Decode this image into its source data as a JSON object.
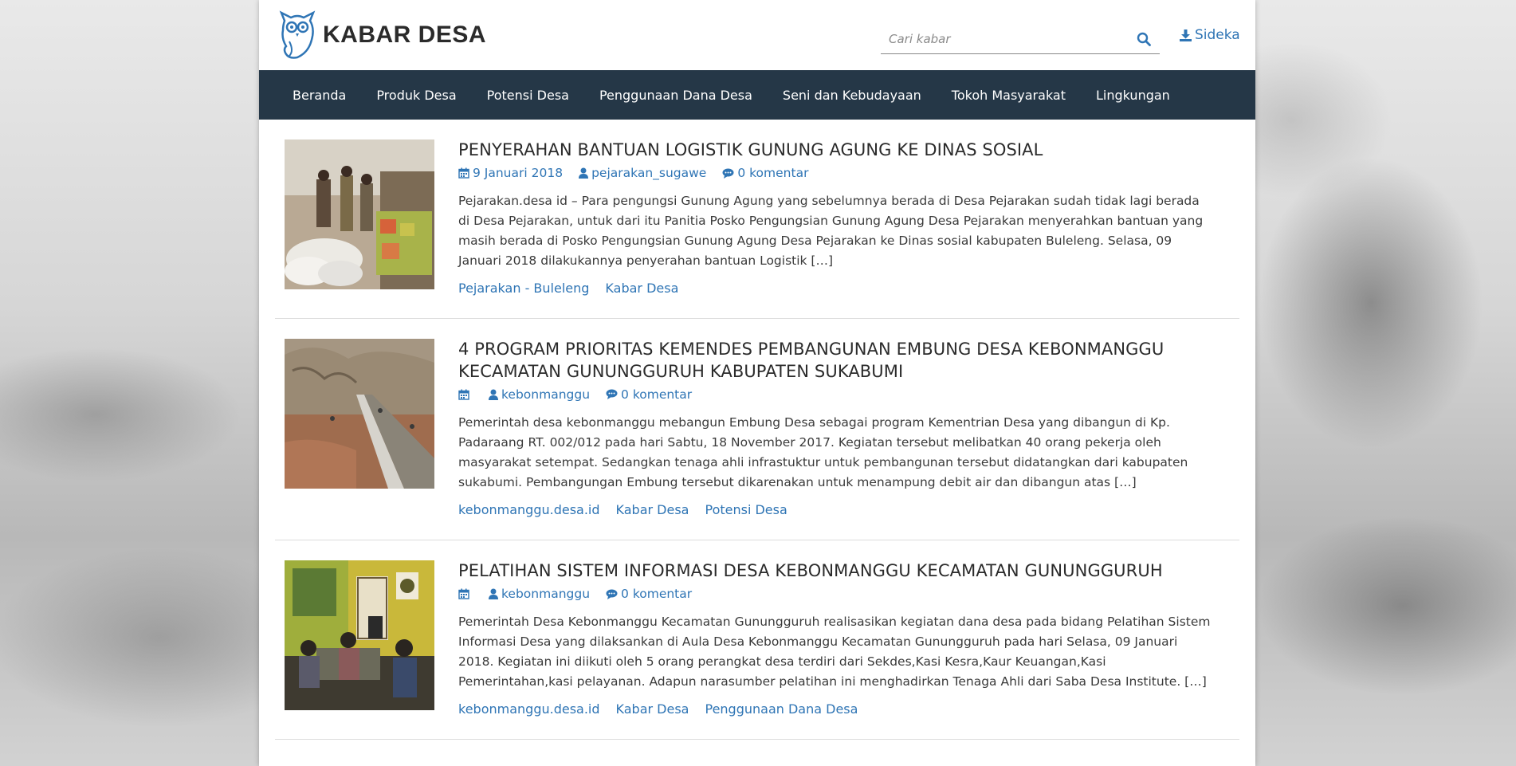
{
  "site": {
    "title": "KABAR DESA",
    "logo_icon": "owl-logo-icon",
    "search_placeholder": "Cari kabar",
    "search_icon": "search-icon",
    "sideka_label": "Sideka",
    "sideka_icon": "download-icon",
    "accent_color": "#2f75b5",
    "nav_bg": "#253747"
  },
  "nav": {
    "items": [
      {
        "label": "Beranda"
      },
      {
        "label": "Produk Desa"
      },
      {
        "label": "Potensi Desa"
      },
      {
        "label": "Penggunaan Dana Desa"
      },
      {
        "label": "Seni dan Kebudayaan"
      },
      {
        "label": "Tokoh Masyarakat"
      },
      {
        "label": "Lingkungan"
      }
    ]
  },
  "posts": [
    {
      "title": "PENYERAHAN BANTUAN LOGISTIK GUNUNG AGUNG KE DINAS SOSIAL",
      "date": "9 Januari 2018",
      "author": "pejarakan_sugawe",
      "comments": "0 komentar",
      "excerpt": "Pejarakan.desa id – Para pengungsi Gunung Agung yang sebelumnya berada di Desa Pejarakan sudah tidak lagi berada di Desa Pejarakan, untuk dari itu Panitia Posko Pengungsian Gunung Agung Desa Pejarakan menyerahkan bantuan yang masih berada di Posko Pengungsian Gunung Agung Desa Pejarakan ke Dinas sosial kabupaten Buleleng. Selasa, 09 Januari 2018 dilakukannya penyerahan bantuan Logistik […]",
      "tags": [
        "Pejarakan - Buleleng",
        "Kabar Desa"
      ]
    },
    {
      "title": "4 PROGRAM PRIORITAS KEMENDES PEMBANGUNAN EMBUNG DESA KEBONMANGGU KECAMATAN GUNUNGGURUH KABUPATEN SUKABUMI",
      "date": "",
      "author": "kebonmanggu",
      "comments": "0 komentar",
      "excerpt": "Pemerintah desa kebonmanggu mebangun Embung Desa sebagai program Kementrian Desa yang dibangun di Kp. Padaraang RT. 002/012 pada hari Sabtu, 18 November 2017. Kegiatan tersebut melibatkan 40 orang pekerja oleh masyarakat setempat. Sedangkan tenaga ahli infrastuktur untuk pembangunan tersebut didatangkan dari kabupaten sukabumi.   Pembangungan Embung tersebut dikarenakan untuk menampung debit air dan dibangun atas […]",
      "tags": [
        "kebonmanggu.desa.id",
        "Kabar Desa",
        "Potensi Desa"
      ]
    },
    {
      "title": "PELATIHAN SISTEM INFORMASI DESA KEBONMANGGU KECAMATAN GUNUNGGURUH",
      "date": "",
      "author": "kebonmanggu",
      "comments": "0 komentar",
      "excerpt": "Pemerintah Desa Kebonmanggu Kecamatan Gunungguruh realisasikan kegiatan dana desa pada bidang  Pelatihan Sistem Informasi Desa yang dilaksankan di Aula Desa Kebonmanggu Kecamatan Gunungguruh pada hari Selasa, 09 Januari 2018. Kegiatan ini diikuti  oleh 5 orang perangkat desa terdiri dari Sekdes,Kasi Kesra,Kaur Keuangan,Kasi Pemerintahan,kasi pelayanan. Adapun narasumber pelatihan ini menghadirkan Tenaga Ahli dari Saba Desa Institute. […]",
      "tags": [
        "kebonmanggu.desa.id",
        "Kabar Desa",
        "Penggunaan Dana Desa"
      ]
    }
  ]
}
